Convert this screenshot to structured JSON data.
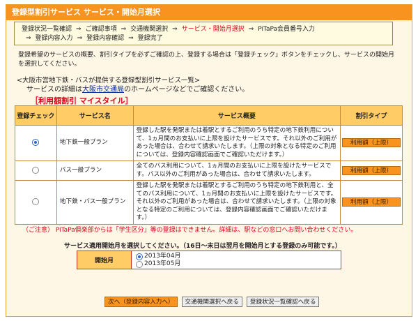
{
  "title": "登録型割引サービス サービス・開始月選択",
  "steps": {
    "line1": [
      "登録状況一覧確認",
      "ご確認事項",
      "交通機関選択",
      "サービス・開始月選択",
      "PiTaPa会員番号入力"
    ],
    "line2": [
      "登録内容入力",
      "登録内容確認",
      "登録完了"
    ],
    "arrow": "⇒"
  },
  "intro": "登録希望のサービスの概要、割引タイプを必ずご確認の上、登録する場合は「登録チェック」ボタンをチェックし、サービスの開始月を選択してください。",
  "list": {
    "heading": "<大阪市営地下鉄・バスが提供する登録型割引サービス一覧>",
    "detail_pre": "サービスの詳細は",
    "detail_link": "大阪市交通局",
    "detail_post": "のホームページなどでご確認ください。",
    "rate_title": "［利用額割引 マイスタイル］"
  },
  "table": {
    "headers": [
      "登録チェック",
      "サービス名",
      "サービス概要",
      "割引タイプ"
    ],
    "rows": [
      {
        "checked": true,
        "name": "地下鉄一般プラン",
        "desc": "登録した駅を発駅または着駅とするご利用のうち特定の地下鉄利用について、1ヵ月間のお支払いに上限を設けたサービスです。それ以外のご利用があった場合は、合わせて請求いたします。（上限の対象となる特定のご利用については、登録内容確認画面でご確認いただけます。）",
        "type": "利用額（上限）"
      },
      {
        "checked": false,
        "name": "バス一般プラン",
        "desc": "全てのバス利用について、1ヵ月間のお支払いに上限を設けたサービスです。バス以外のご利用があった場合は、合わせて請求いたします。",
        "type": "利用額（上限）"
      },
      {
        "checked": false,
        "name": "地下鉄・バス一般プラン",
        "desc": "登録した駅を発駅または着駅とするご利用のうち特定の地下鉄利用と、全てのバス利用について、1ヵ月間のお支払いに上限を設けたサービスです。それ以外のご利用があった場合は、合わせて請求いたします。（上限の対象となる特定のご利用については、登録内容確認画面でご確認いただけます。）",
        "type": "利用額（上限）"
      }
    ]
  },
  "notice": "（ご注意） PiTaPa倶楽部からは「学生区分」等の登録はできません。詳細は、駅などの窓口へお問い合わせください。",
  "start": {
    "question": "サービス適用開始月を選択してください。（16日〜末日は翌月を開始月とする登録のみ可能です。）",
    "label": "開始月",
    "options": [
      {
        "label": "2013年04月",
        "selected": true
      },
      {
        "label": "2013年05月",
        "selected": false
      }
    ]
  },
  "buttons": {
    "next": "次へ（登録内容入力へ）",
    "back_transport": "交通機関選択へ戻る",
    "back_list": "登録状況一覧確認へ戻る"
  },
  "colors": {
    "accent": "#f7931e",
    "header_cell": "#ffcc66",
    "alert": "#e2001a"
  }
}
